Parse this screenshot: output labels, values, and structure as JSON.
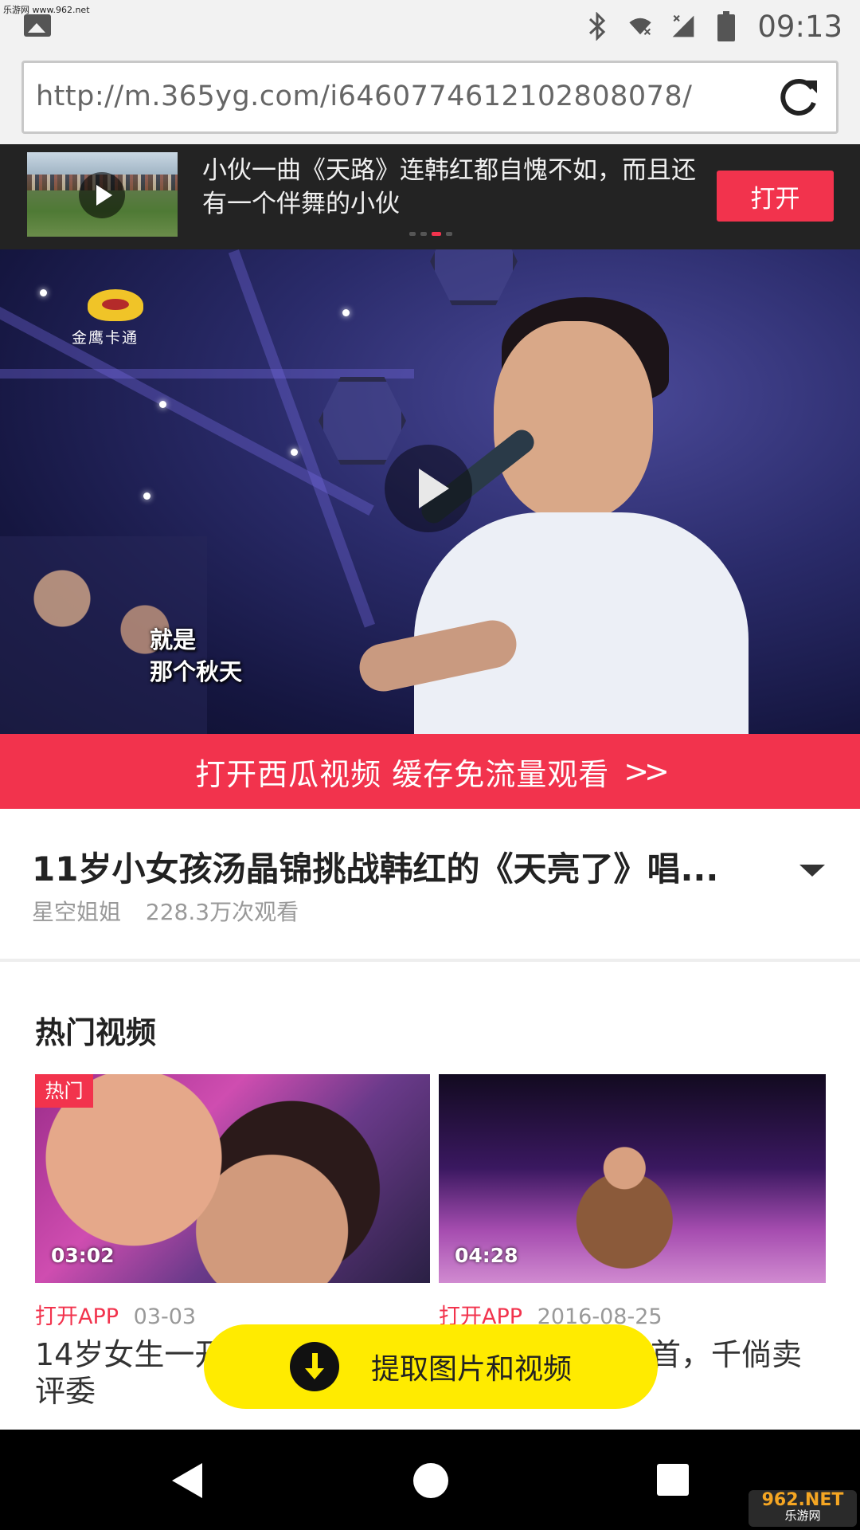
{
  "status_bar": {
    "watermark": "乐游网 www.962.net",
    "time": "09:13",
    "icons": [
      "image-icon",
      "bluetooth-icon",
      "wifi-off-icon",
      "signal-no-icon",
      "battery-icon"
    ]
  },
  "browser": {
    "url": "http://m.365yg.com/i6460774612102808078/"
  },
  "banner": {
    "text": "小伙一曲《天路》连韩红都自愧不如，而且还有一个伴舞的小伙",
    "open_label": "打开",
    "dots": 4,
    "active_dot": 3
  },
  "player": {
    "station_logo": "金鹰卡通",
    "subtitle_line1": "就是",
    "subtitle_line2": "那个秋天"
  },
  "open_bar": {
    "label": "打开西瓜视频 缓存免流量观看",
    "chevrons": ">>"
  },
  "video": {
    "title": "11岁小女孩汤晶锦挑战韩红的《天亮了》唱...",
    "author": "星空姐姐",
    "views": "228.3万次观看"
  },
  "hot": {
    "heading": "热门视频",
    "items": [
      {
        "tag": "热门",
        "duration": "03:02",
        "app_label": "打开APP",
        "date": "03-03",
        "title": "14岁女生一开口，唱哭全场评委"
      },
      {
        "tag": "",
        "duration": "04:28",
        "app_label": "打开APP",
        "date": "2016-08-25",
        "title": "女孩现场唱了一首，千倘卖无..."
      }
    ]
  },
  "extract": {
    "label": "提取图片和视频"
  },
  "corner_logo": {
    "brand": "962.NET",
    "sub": "乐游网"
  },
  "colors": {
    "accent": "#f2334d",
    "extract_bg": "#ffeb00",
    "banner_bg": "#232323"
  }
}
